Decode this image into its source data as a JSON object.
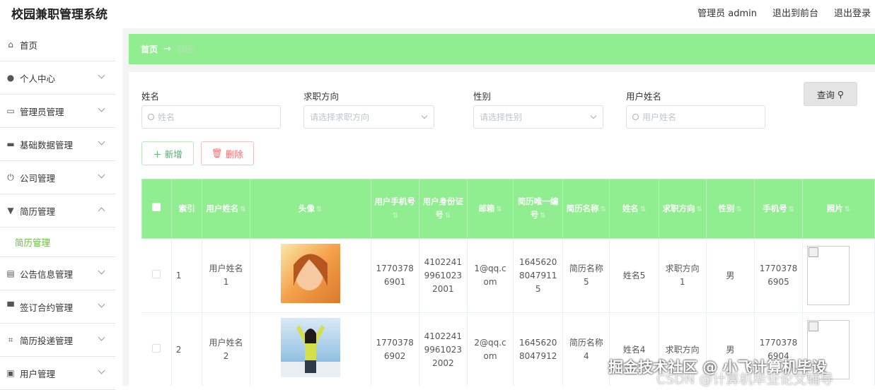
{
  "app": {
    "title": "校园兼职管理系统"
  },
  "topnav": {
    "user": "管理员 admin",
    "front": "退出到前台",
    "logout": "退出登录"
  },
  "sidebar": {
    "items": [
      {
        "label": "首页"
      },
      {
        "label": "个人中心"
      },
      {
        "label": "管理员管理"
      },
      {
        "label": "基础数据管理"
      },
      {
        "label": "公司管理"
      },
      {
        "label": "简历管理"
      },
      {
        "label": "公告信息管理"
      },
      {
        "label": "签订合约管理"
      },
      {
        "label": "简历投递管理"
      },
      {
        "label": "用户管理"
      }
    ],
    "sub_active": "简历管理"
  },
  "breadcrumb": {
    "home": "首页",
    "arrow": "→",
    "current": "简历"
  },
  "filters": {
    "name_label": "姓名",
    "name_placeholder": "姓名",
    "direction_label": "求职方向",
    "direction_placeholder": "请选择求职方向",
    "gender_label": "性别",
    "gender_placeholder": "请选择性别",
    "username_label": "用户姓名",
    "username_placeholder": "用户姓名"
  },
  "buttons": {
    "query": "查询",
    "add": "新增",
    "delete": "删除"
  },
  "table": {
    "columns": [
      "索引",
      "用户姓名",
      "头像",
      "用户手机号",
      "用户身份证号",
      "邮箱",
      "简历唯一编号",
      "简历名称",
      "姓名",
      "求职方向",
      "性别",
      "手机号",
      "照片"
    ],
    "rows": [
      {
        "index": "1",
        "username": "用户姓名1",
        "phone": "17703786901",
        "idcard": "410224199610232001",
        "email": "1@qq.com",
        "code": "16456208047911 5",
        "resume": "简历名称5",
        "name": "姓名5",
        "direction": "求职方向1",
        "gender": "男",
        "mobile": "17703786905"
      },
      {
        "index": "2",
        "username": "用户姓名2",
        "phone": "17703786902",
        "idcard": "410224199610232002",
        "email": "2@qq.com",
        "code": "16456208047912",
        "resume": "简历名称4",
        "name": "姓名4",
        "direction": "求职方向",
        "gender": "男",
        "mobile": "17703786904"
      }
    ]
  },
  "watermark": {
    "line1": "掘金技术社区 @ 小飞计算机毕设",
    "line2": "CSDN @计算机毕业论文辅导"
  }
}
